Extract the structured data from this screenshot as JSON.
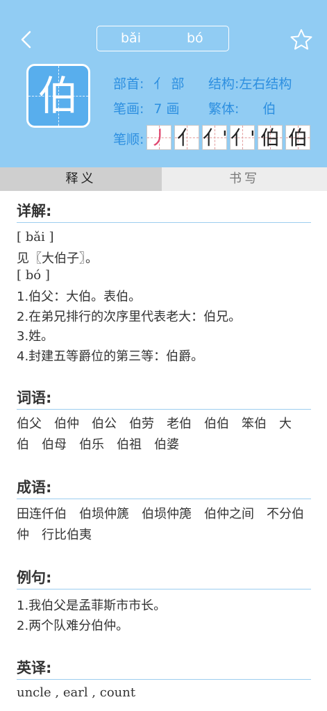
{
  "header": {
    "pinyin": [
      "bǎi",
      "bó"
    ],
    "character": "伯",
    "radical_label": "部首:",
    "radical_value": "亻 部",
    "structure_label": "结构:",
    "structure_value": "左右结构",
    "strokes_label": "笔画:",
    "strokes_value": "7 画",
    "traditional_label": "繁体:",
    "traditional_value": "伯",
    "order_label": "笔顺:",
    "stroke_steps": [
      "丿",
      "亻",
      "亻'",
      "亻'",
      "伯",
      "伯"
    ]
  },
  "tabs": [
    "释义",
    "书写"
  ],
  "sections": {
    "detail_title": "详解:",
    "detail_lines": [
      "[ bǎi ]",
      "见〖大伯子〗。",
      "[ bó ]",
      "1.伯父：大伯。表伯。",
      "2.在弟兄排行的次序里代表老大：伯兄。",
      "3.姓。",
      "4.封建五等爵位的第三等：伯爵。"
    ],
    "words_title": "词语:",
    "words": [
      "伯父",
      "伯仲",
      "伯公",
      "伯劳",
      "老伯",
      "伯伯",
      "笨伯",
      "大伯",
      "伯母",
      "伯乐",
      "伯祖",
      "伯婆"
    ],
    "idioms_title": "成语:",
    "idioms": [
      "田连仟伯",
      "伯埙仲篪",
      "伯埙仲箎",
      "伯仲之间",
      "不分伯仲",
      "行比伯夷"
    ],
    "examples_title": "例句:",
    "examples": [
      "1.我伯父是孟菲斯市市长。",
      "2.两个队难分伯仲。"
    ],
    "english_title": "英译:",
    "english": "uncle , earl , count"
  }
}
